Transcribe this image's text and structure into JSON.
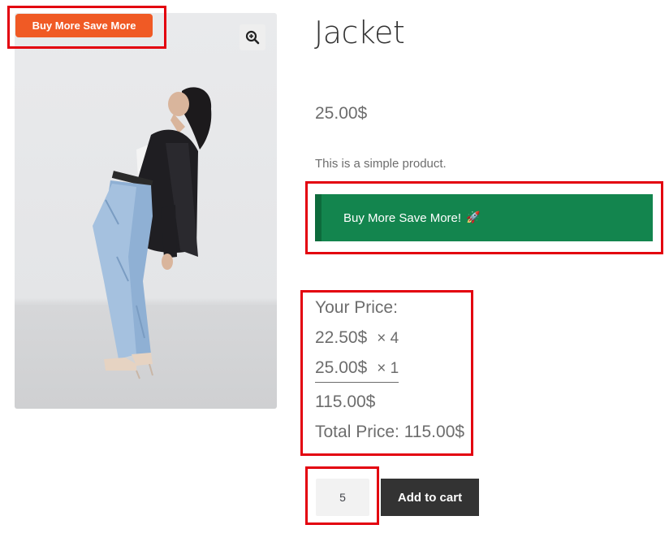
{
  "product": {
    "badge": "Buy More Save More",
    "title": "Jacket",
    "price": "25.00$",
    "description": "This is a simple product.",
    "image_alt": "Woman in black jacket and jeans leaning back"
  },
  "promo": {
    "label": "Buy More Save More!",
    "emoji": "🚀",
    "background": "#13854e"
  },
  "pricing": {
    "heading": "Your Price:",
    "tiers": [
      {
        "price": "22.50$",
        "qty": "× 4"
      },
      {
        "price": "25.00$",
        "qty": "× 1"
      }
    ],
    "subtotal": "115.00$",
    "total_label": "Total Price: 115.00$"
  },
  "cart": {
    "quantity": "5",
    "button_label": "Add to cart"
  },
  "colors": {
    "badge": "#f05a25",
    "highlight": "#e3000f",
    "cart_button": "#333333"
  },
  "icons": {
    "zoom": "zoom-in-icon"
  }
}
